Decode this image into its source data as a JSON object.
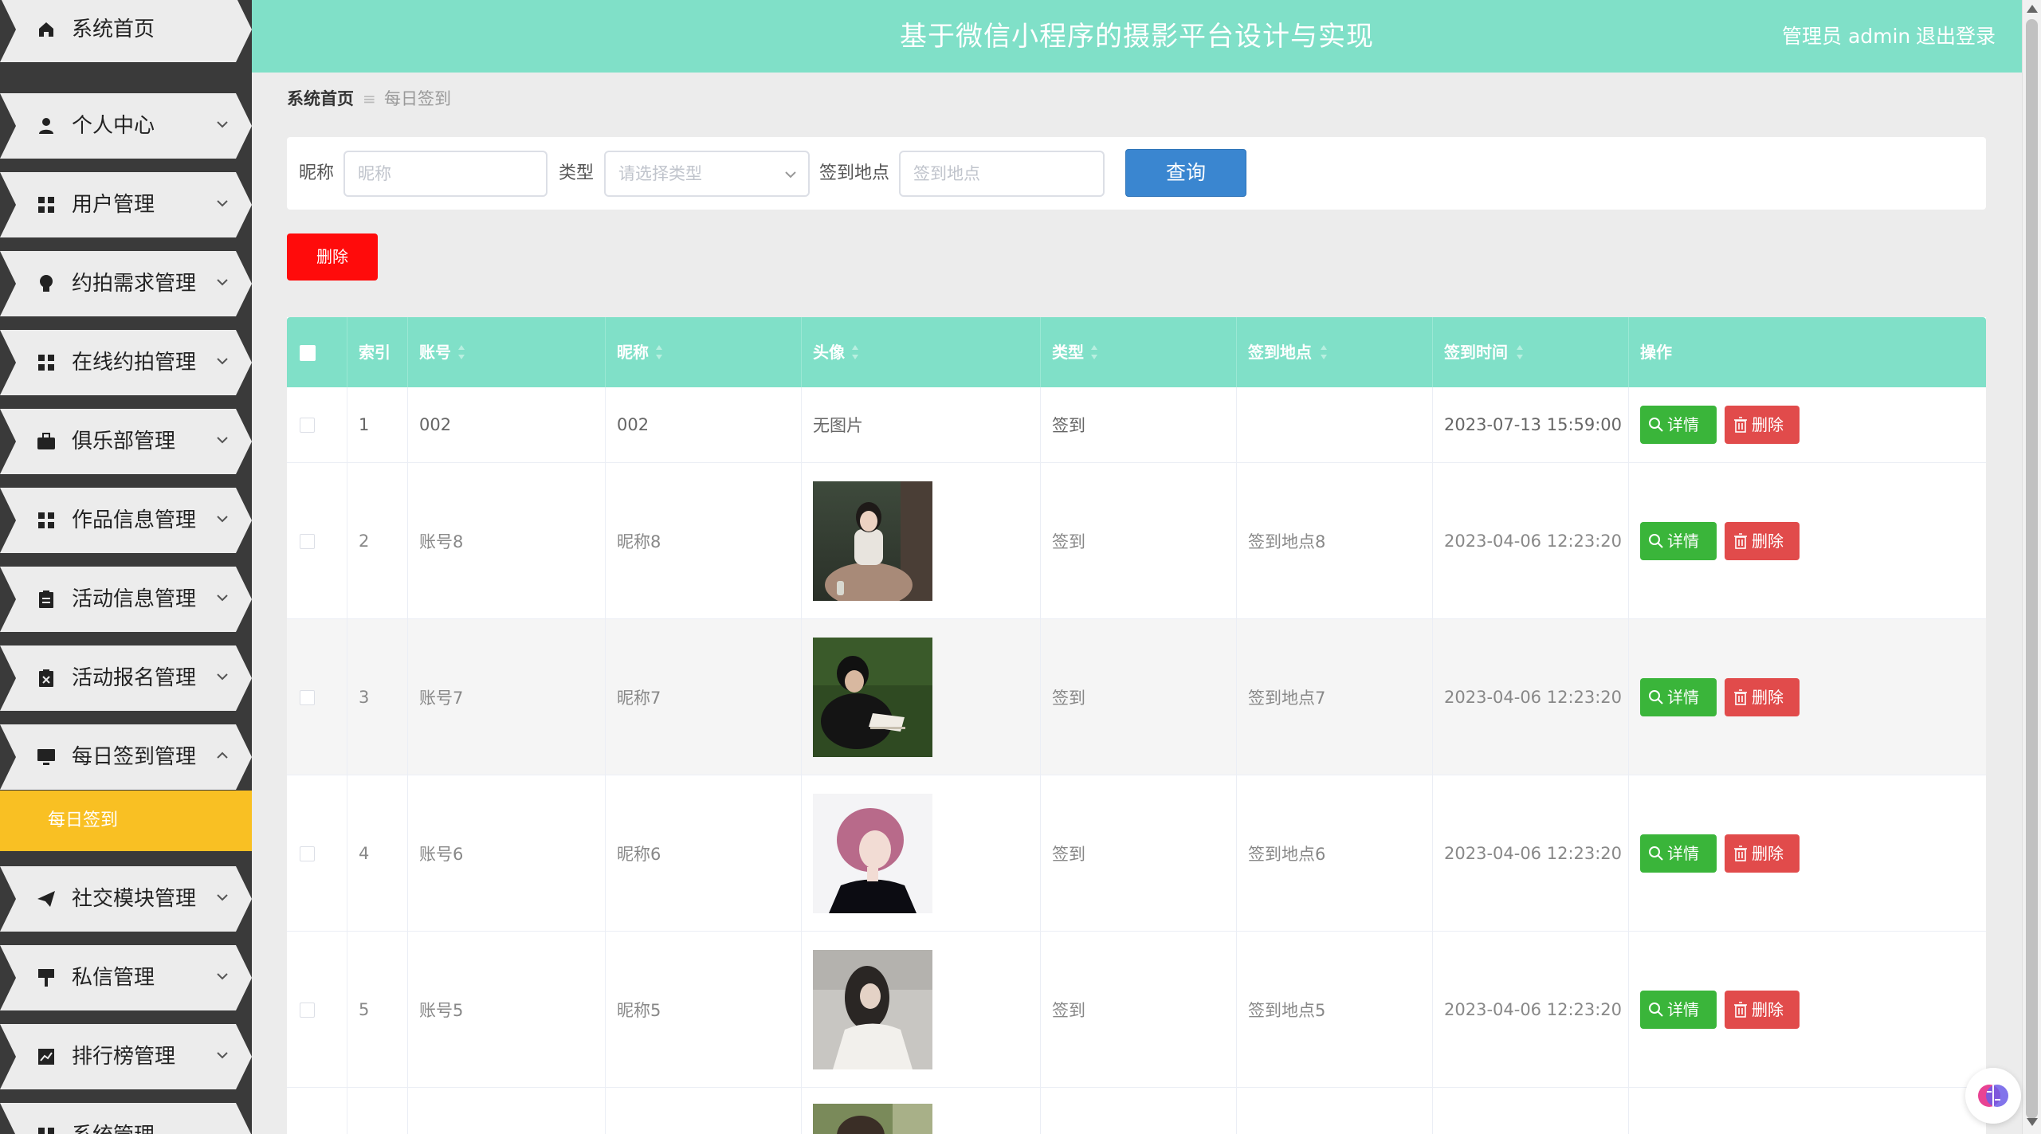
{
  "app": {
    "title": "基于微信小程序的摄影平台设计与实现",
    "admin_label": "管理员 admin",
    "logout": "退出登录"
  },
  "sidebar": {
    "items": [
      {
        "label": "系统首页",
        "icon": "home-icon"
      },
      {
        "label": "个人中心",
        "icon": "user-icon"
      },
      {
        "label": "用户管理",
        "icon": "grid-icon"
      },
      {
        "label": "约拍需求管理",
        "icon": "lightbulb-icon"
      },
      {
        "label": "在线约拍管理",
        "icon": "grid-icon"
      },
      {
        "label": "俱乐部管理",
        "icon": "briefcase-icon"
      },
      {
        "label": "作品信息管理",
        "icon": "grid-icon"
      },
      {
        "label": "活动信息管理",
        "icon": "clipboard-icon"
      },
      {
        "label": "活动报名管理",
        "icon": "clipboard-x-icon"
      },
      {
        "label": "每日签到管理",
        "icon": "monitor-icon"
      },
      {
        "label": "社交模块管理",
        "icon": "send-icon"
      },
      {
        "label": "私信管理",
        "icon": "sign-icon"
      },
      {
        "label": "排行榜管理",
        "icon": "chart-icon"
      },
      {
        "label": "系统管理",
        "icon": "grid-icon"
      }
    ],
    "active_sub": "每日签到"
  },
  "breadcrumb": {
    "home": "系统首页",
    "current": "每日签到"
  },
  "search": {
    "nickname_label": "昵称",
    "nickname_placeholder": "昵称",
    "type_label": "类型",
    "type_placeholder": "请选择类型",
    "location_label": "签到地点",
    "location_placeholder": "签到地点",
    "query_button": "查询"
  },
  "actions": {
    "bulk_delete": "删除"
  },
  "table": {
    "columns": [
      "索引",
      "账号",
      "昵称",
      "头像",
      "类型",
      "签到地点",
      "签到时间",
      "操作"
    ],
    "detail_label": "详情",
    "delete_label": "删除",
    "rows": [
      {
        "index": "1",
        "account": "002",
        "nickname": "002",
        "avatar": "无图片",
        "type": "签到",
        "location": "",
        "time": "2023-07-13 15:59:00"
      },
      {
        "index": "2",
        "account": "账号8",
        "nickname": "昵称8",
        "avatar": "photo",
        "type": "签到",
        "location": "签到地点8",
        "time": "2023-04-06 12:23:20"
      },
      {
        "index": "3",
        "account": "账号7",
        "nickname": "昵称7",
        "avatar": "photo",
        "type": "签到",
        "location": "签到地点7",
        "time": "2023-04-06 12:23:20"
      },
      {
        "index": "4",
        "account": "账号6",
        "nickname": "昵称6",
        "avatar": "photo",
        "type": "签到",
        "location": "签到地点6",
        "time": "2023-04-06 12:23:20"
      },
      {
        "index": "5",
        "account": "账号5",
        "nickname": "昵称5",
        "avatar": "photo",
        "type": "签到",
        "location": "签到地点5",
        "time": "2023-04-06 12:23:20"
      }
    ]
  },
  "colors": {
    "header_bg": "#80e0c8",
    "sidebar_active": "#f9c023",
    "query_button": "#3a86d0",
    "bulk_delete": "#ff0b0b",
    "detail_button": "#3ab53a",
    "delete_button": "#e14b4b"
  }
}
